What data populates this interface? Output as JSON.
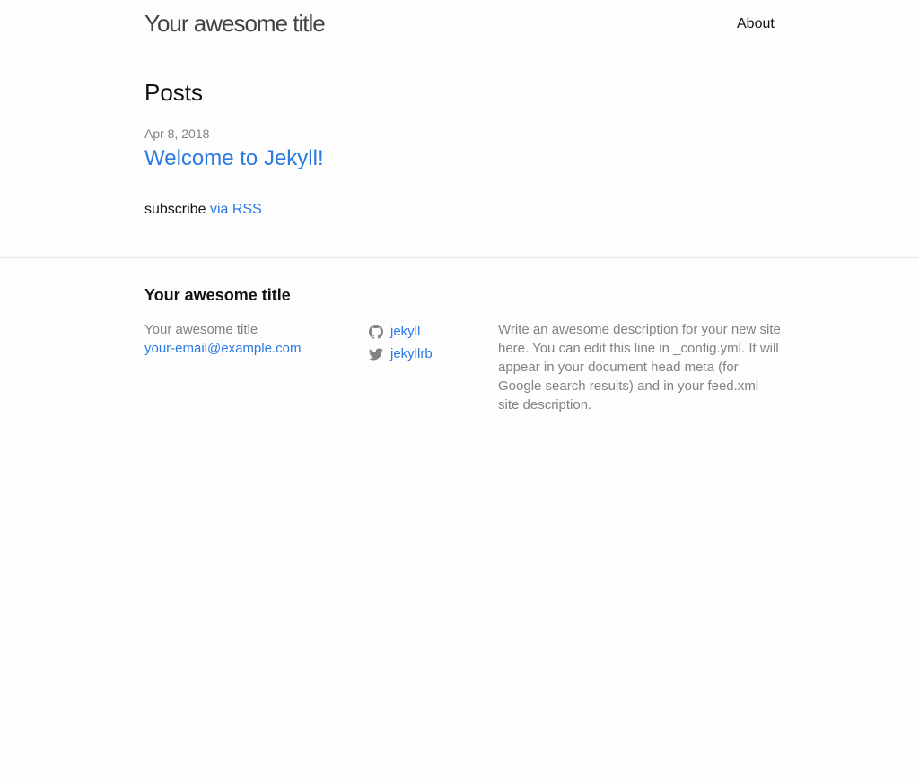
{
  "header": {
    "site_title": "Your awesome title",
    "nav": [
      {
        "label": "About"
      }
    ]
  },
  "main": {
    "heading": "Posts",
    "posts": [
      {
        "date": "Apr 8, 2018",
        "title": "Welcome to Jekyll!"
      }
    ],
    "rss": {
      "prefix": "subscribe",
      "link": "via RSS"
    }
  },
  "footer": {
    "heading": "Your awesome title",
    "name": "Your awesome title",
    "email": "your-email@example.com",
    "social": [
      {
        "icon": "github-icon",
        "label": "jekyll"
      },
      {
        "icon": "twitter-icon",
        "label": "jekyllrb"
      }
    ],
    "description": "Write an awesome description for your new site here. You can edit this line in _config.yml. It will appear in your document head meta (for Google search results) and in your feed.xml site description."
  },
  "colors": {
    "link": "#2a7ae2",
    "text": "#111111",
    "muted": "#828282",
    "border": "#e8e8e8",
    "background": "#fdfdfd"
  }
}
